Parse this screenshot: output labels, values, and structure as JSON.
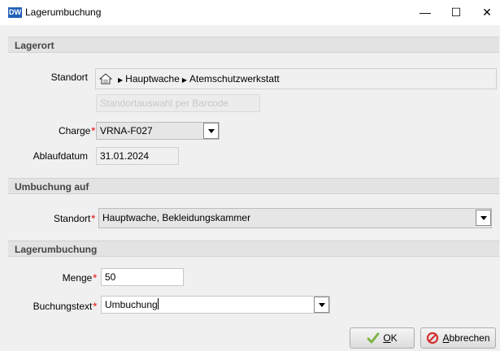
{
  "window": {
    "icon_text": "DW",
    "title": "Lagerumbuchung",
    "minimize": "—",
    "maximize": "☐",
    "close": "✕"
  },
  "lagerort": {
    "header": "Lagerort",
    "standort_label": "Standort",
    "standort_path": [
      "Hauptwache",
      "Atemschutzwerkstatt"
    ],
    "barcode_placeholder": "Standortauswahl per Barcode",
    "charge_label": "Charge",
    "charge_value": "VRNA-F027",
    "ablaufdatum_label": "Ablaufdatum",
    "ablaufdatum_value": "31.01.2024"
  },
  "umbuchung_auf": {
    "header": "Umbuchung auf",
    "standort_label": "Standort",
    "standort_value": "Hauptwache, Bekleidungskammer"
  },
  "lagerumbuchung": {
    "header": "Lagerumbuchung",
    "menge_label": "Menge",
    "menge_value": "50",
    "buchungstext_label": "Buchungstext",
    "buchungstext_value": "Umbuchung"
  },
  "required_marker": "*",
  "buttons": {
    "ok_accel": "O",
    "ok_rest": "K",
    "abbrechen_accel": "A",
    "abbrechen_rest": "bbrechen"
  },
  "colors": {
    "required": "#e53935",
    "app_icon": "#1f5fb8"
  }
}
